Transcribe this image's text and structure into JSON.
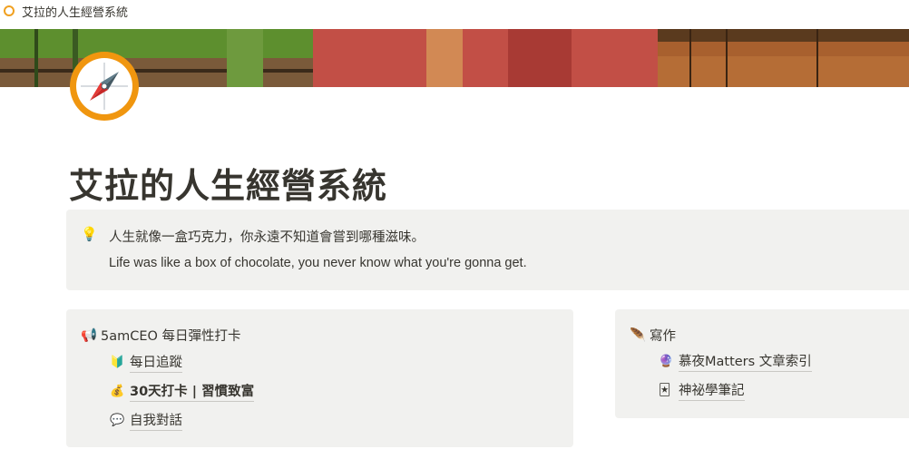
{
  "window": {
    "title": "艾拉的人生經營系統"
  },
  "page": {
    "title": "艾拉的人生經營系統",
    "callout": {
      "line1": "人生就像一盒巧克力，你永遠不知道會嘗到哪種滋味。",
      "line2": "Life was like a box of chocolate, you never know what you're gonna get."
    }
  },
  "left_box": {
    "heading": "5amCEO 每日彈性打卡",
    "items": [
      {
        "label": "每日追蹤",
        "icon": "beginner-badge-icon"
      },
      {
        "label": "30天打卡 | 習慣致富",
        "icon": "money-bag-icon"
      },
      {
        "label": "自我對話",
        "icon": "speech-bubble-icon"
      }
    ]
  },
  "right_box": {
    "heading": "寫作",
    "items": [
      {
        "label": "慕夜Matters 文章索引",
        "icon": "crystal-ball-icon"
      },
      {
        "label": "神祕學筆記",
        "icon": "tarot-card-icon"
      }
    ]
  },
  "colors": {
    "accent_orange": "#f0960f",
    "callout_bg": "#f1f1ef"
  }
}
